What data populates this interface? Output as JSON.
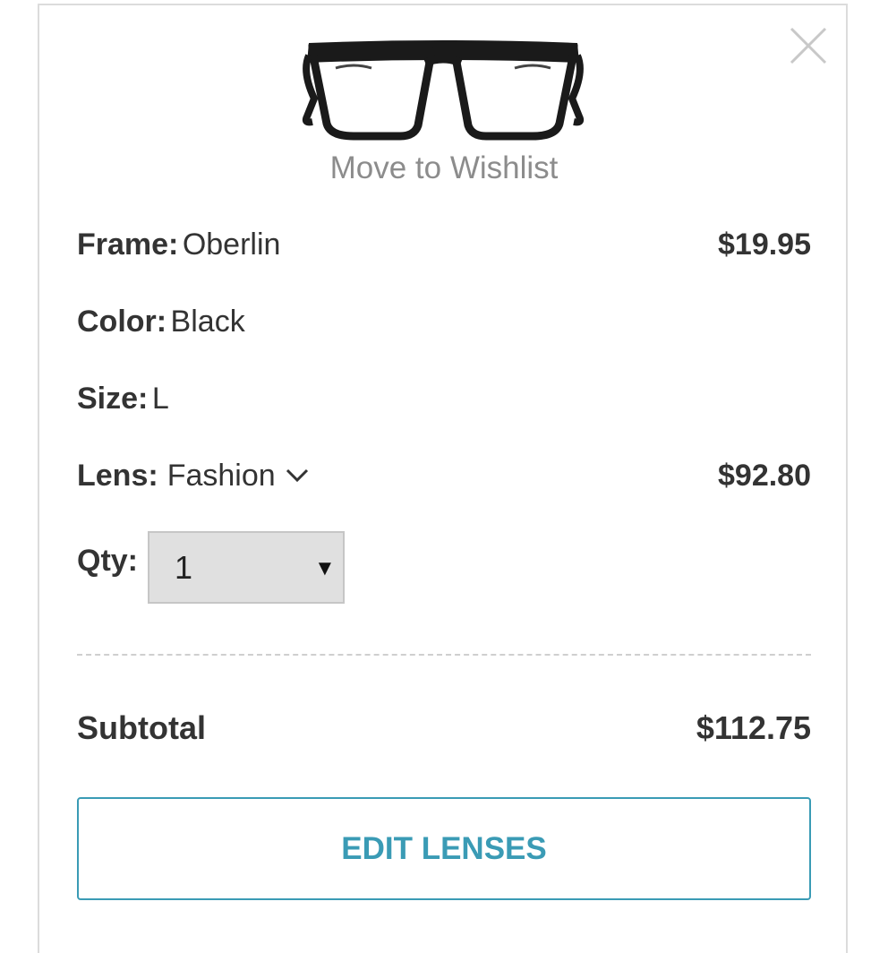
{
  "wishlist_label": "Move to Wishlist",
  "details": {
    "frame_key": "Frame:",
    "frame_value": "Oberlin",
    "frame_price": "$19.95",
    "color_key": "Color:",
    "color_value": "Black",
    "size_key": "Size:",
    "size_value": "L",
    "lens_key": "Lens:",
    "lens_value": "Fashion",
    "lens_price": "$92.80",
    "qty_key": "Qty:",
    "qty_value": "1"
  },
  "subtotal": {
    "label": "Subtotal",
    "value": "$112.75"
  },
  "edit_button": "EDIT LENSES",
  "icons": {
    "close": "close-icon",
    "lens_dropdown": "chevron-down-icon",
    "qty_dropdown": "caret-down-icon"
  },
  "colors": {
    "accent": "#3a9bb5",
    "muted_text": "#8c8c8c",
    "text": "#333333"
  }
}
